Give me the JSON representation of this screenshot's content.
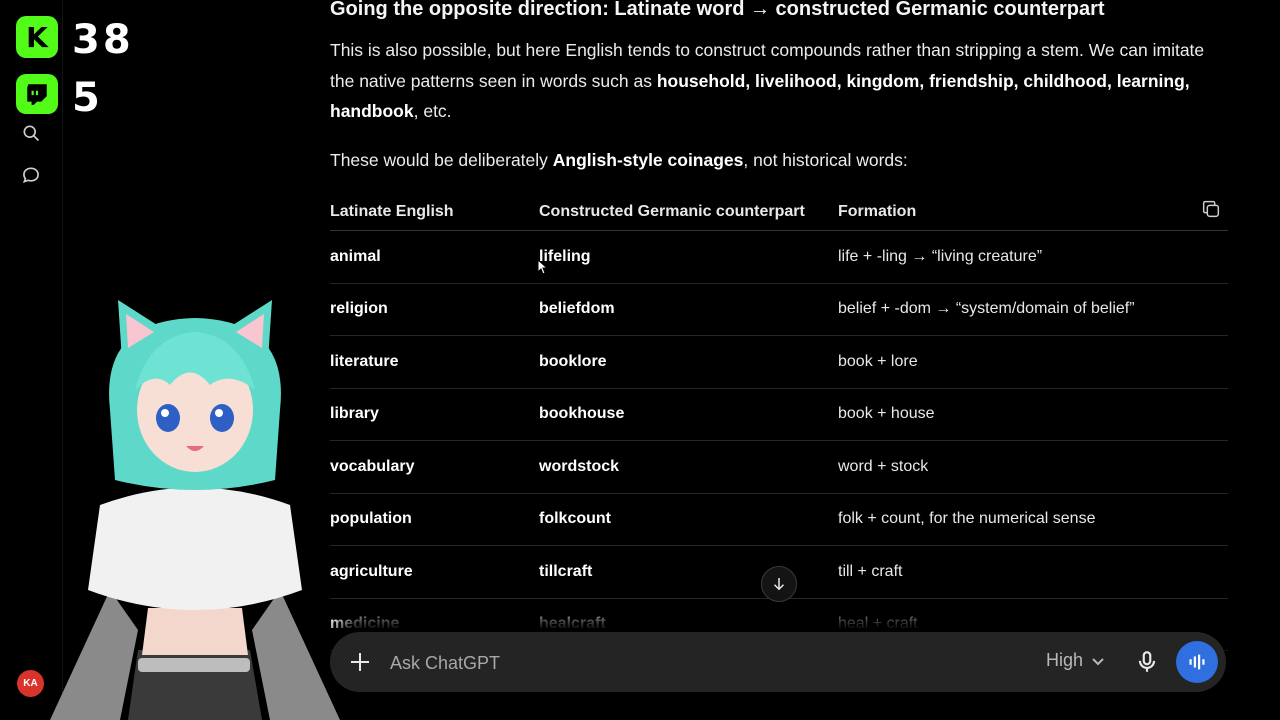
{
  "overlay": {
    "kick_letter": "K",
    "kick_count": "38",
    "twitch_count": "5",
    "accent_color": "#53fc18"
  },
  "sidebar": {
    "icons": [
      "search-icon",
      "chat-bubble-icon"
    ],
    "avatar_initials": "KA",
    "avatar_color": "#d9342b"
  },
  "content": {
    "heading": "Going the opposite direction: Latinate word → constructed Germanic counterpart",
    "para1": {
      "text": "This is also possible, but here English tends to construct compounds rather than stripping a stem. We can imitate the native patterns seen in words such as ",
      "bold": "household, livelihood, kingdom, friendship, childhood, learning, handbook",
      "tail": ", etc."
    },
    "para2": {
      "lead": "These would be deliberately ",
      "bold": "Anglish-style coinages",
      "tail": ", not historical words:"
    },
    "table": {
      "headers": [
        "Latinate English",
        "Constructed Germanic counterpart",
        "Formation"
      ],
      "rows": [
        [
          "animal",
          "lifeling",
          "life + -ling → “living creature”"
        ],
        [
          "religion",
          "beliefdom",
          "belief + -dom → “system/domain of belief”"
        ],
        [
          "literature",
          "booklore",
          "book + lore"
        ],
        [
          "library",
          "bookhouse",
          "book + house"
        ],
        [
          "vocabulary",
          "wordstock",
          "word + stock"
        ],
        [
          "population",
          "folkcount",
          "folk + count, for the numerical sense"
        ],
        [
          "agriculture",
          "tillcraft",
          "till + craft"
        ],
        [
          "medicine",
          "healcraft",
          "heal + craft"
        ]
      ]
    }
  },
  "composer": {
    "placeholder": "Ask ChatGPT",
    "model_label": "High",
    "voice_color": "#2f6fe0"
  }
}
